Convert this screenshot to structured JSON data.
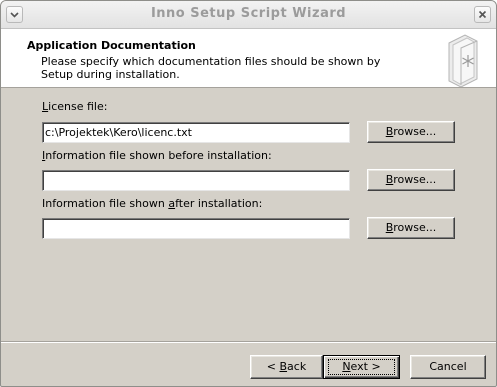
{
  "window": {
    "title": "Inno Setup Script Wizard"
  },
  "header": {
    "title": "Application Documentation",
    "description": "Please specify which documentation files should be shown by Setup during installation."
  },
  "fields": [
    {
      "label_pre": "",
      "label_accel": "L",
      "label_post": "icense file:",
      "value": "c:\\Projektek\\Kero\\licenc.txt",
      "browse_pre": "B",
      "browse_post": "rowse..."
    },
    {
      "label_pre": "",
      "label_accel": "I",
      "label_post": "nformation file shown before installation:",
      "value": "",
      "browse_pre": "B",
      "browse_post": "rowse..."
    },
    {
      "label_pre": "Information file shown ",
      "label_accel": "a",
      "label_post": "fter installation:",
      "value": "",
      "browse_pre": "B",
      "browse_post": "rowse..."
    }
  ],
  "footer": {
    "back_pre": "< ",
    "back_accel": "B",
    "back_post": "ack",
    "next_pre": "",
    "next_accel": "N",
    "next_post": "ext >",
    "cancel": "Cancel"
  }
}
